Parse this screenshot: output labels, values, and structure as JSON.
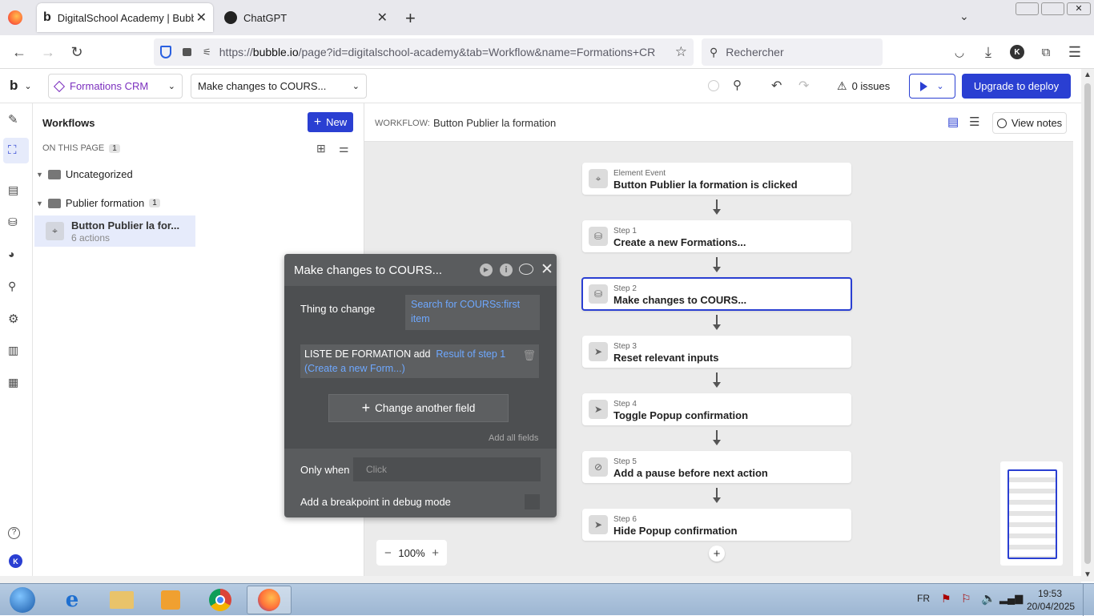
{
  "browser": {
    "tabs": [
      {
        "title": "DigitalSchool Academy | Bubble"
      },
      {
        "title": "ChatGPT"
      }
    ],
    "url_prefix": "https://",
    "url_host": "bubble.io",
    "url_rest": "/page?id=digitalschool-academy&tab=Workflow&name=Formations+CR",
    "search_placeholder": "Rechercher",
    "profile_initial": "K"
  },
  "header": {
    "logo": "b",
    "page_select": "Formations CRM",
    "action_select": "Make changes to COURS...",
    "issues": "0 issues",
    "deploy_label": "Upgrade to deploy"
  },
  "workflows_panel": {
    "title": "Workflows",
    "new_label": "New",
    "on_this_page": "ON THIS PAGE",
    "on_this_page_count": "1",
    "folders": [
      {
        "name": "Uncategorized"
      },
      {
        "name": "Publier formation",
        "count": "1"
      }
    ],
    "item": {
      "title": "Button Publier la for...",
      "subtitle": "6 actions"
    }
  },
  "workflow_bar": {
    "label": "WORKFLOW:",
    "name": "Button Publier la formation",
    "view_notes": "View notes"
  },
  "steps": [
    {
      "sub": "Element Event",
      "title": "Button Publier la formation is clicked",
      "icon": "cursor-click-icon"
    },
    {
      "sub": "Step 1",
      "title": "Create a new Formations...",
      "icon": "database-icon"
    },
    {
      "sub": "Step 2",
      "title": "Make changes to COURS...",
      "icon": "database-icon",
      "selected": true
    },
    {
      "sub": "Step 3",
      "title": "Reset relevant inputs",
      "icon": "pointer-icon"
    },
    {
      "sub": "Step 4",
      "title": "Toggle Popup confirmation",
      "icon": "pointer-icon"
    },
    {
      "sub": "Step 5",
      "title": "Add a pause before next action",
      "icon": "pause-icon"
    },
    {
      "sub": "Step 6",
      "title": "Hide Popup confirmation",
      "icon": "pointer-icon"
    }
  ],
  "zoom": "100%",
  "popup": {
    "title": "Make changes to COURS...",
    "thing_label": "Thing to change",
    "thing_value": "Search for COURSs:first item",
    "field_name": "LISTE DE FORMATION add",
    "field_value": "Result of step 1 (Create a new Form...)",
    "change_another": "Change another field",
    "add_all": "Add all fields",
    "only_when_label": "Only when",
    "only_when_placeholder": "Click",
    "breakpoint_label": "Add a breakpoint in debug mode"
  },
  "taskbar": {
    "lang": "FR",
    "time": "19:53",
    "date": "20/04/2025"
  },
  "colors": {
    "accent": "#2a3fd2",
    "brand_purple": "#7b2fbe",
    "link_blue": "#6ea8ff"
  }
}
